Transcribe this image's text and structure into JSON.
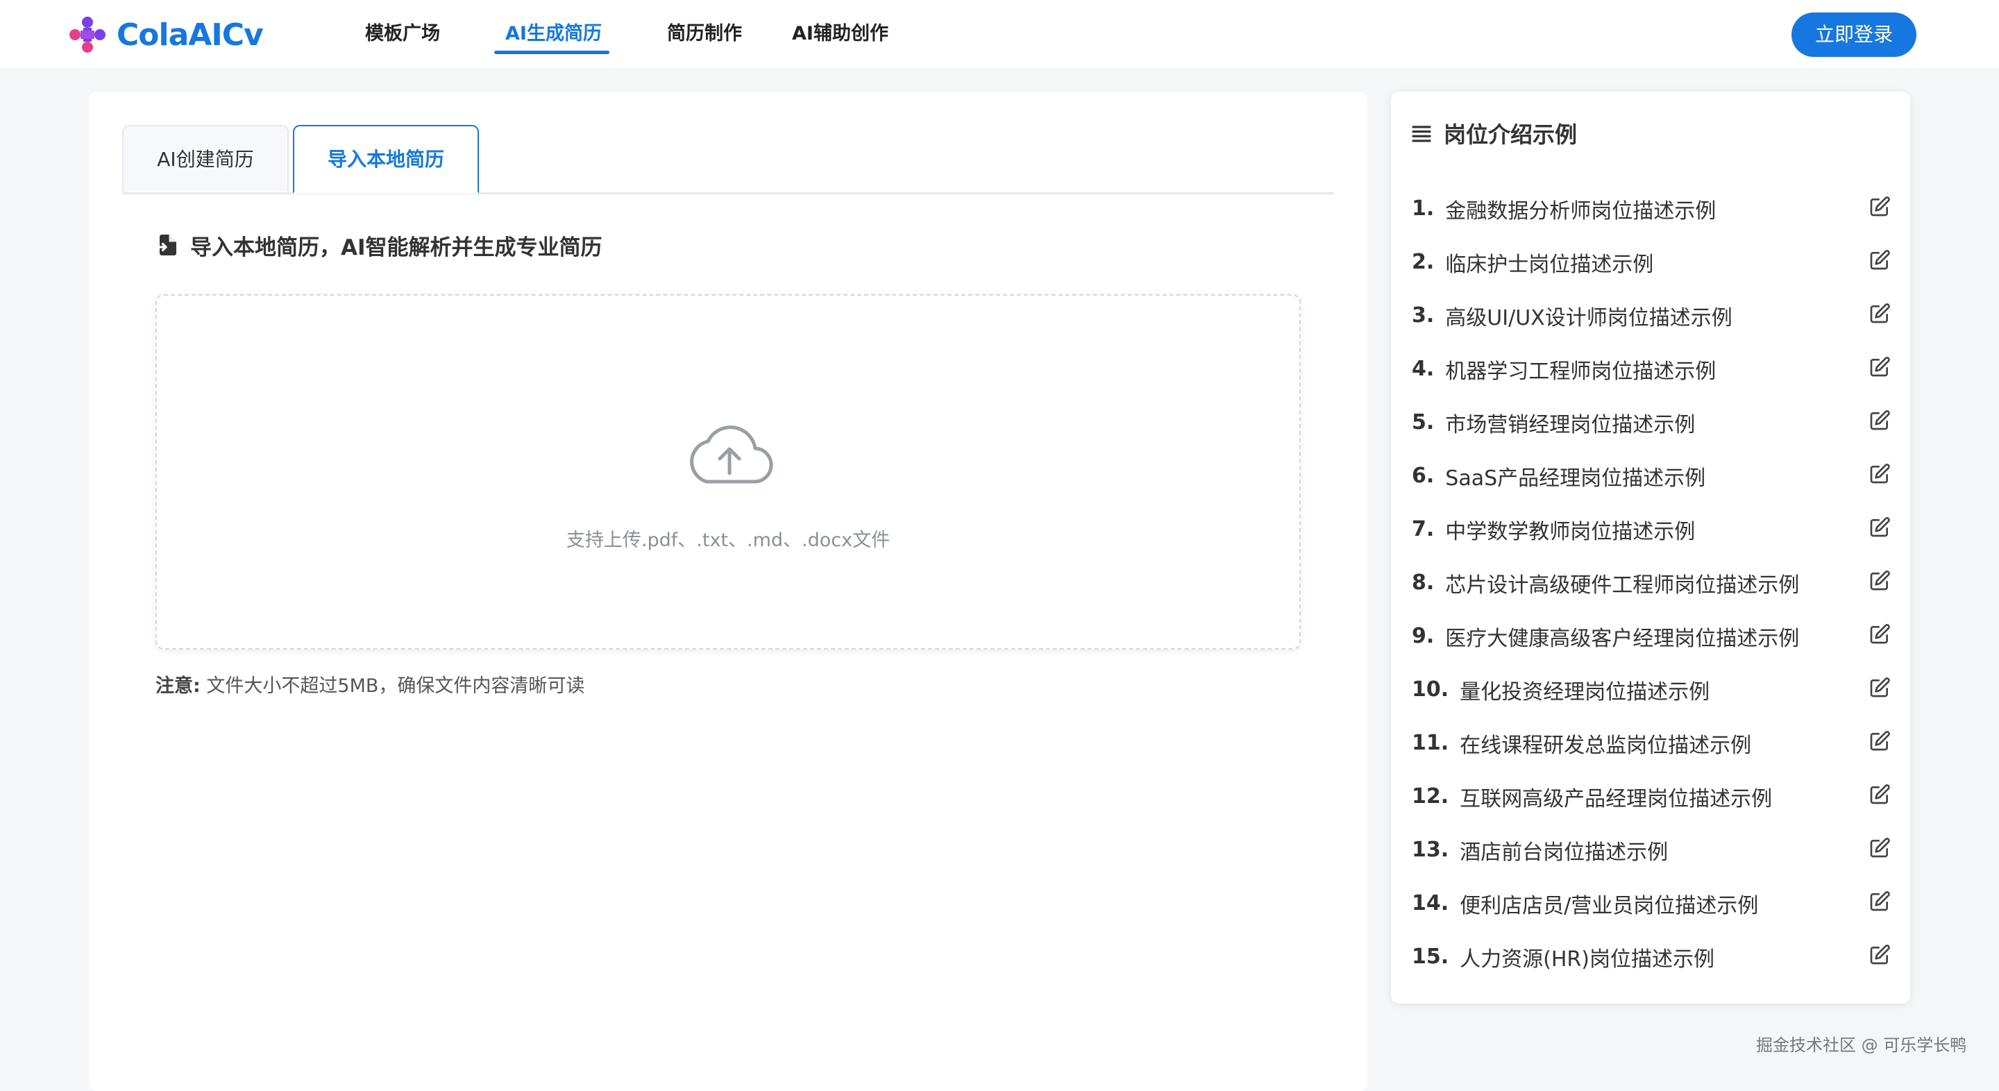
{
  "header": {
    "logo_text": "ColaAICv",
    "nav": [
      "模板广场",
      "AI生成简历",
      "简历制作",
      "AI辅助创作"
    ],
    "login_label": "立即登录"
  },
  "main": {
    "tabs": [
      "AI创建简历",
      "导入本地简历"
    ],
    "import_title": "导入本地简历，AI智能解析并生成专业简历",
    "upload_hint": "支持上传.pdf、.txt、.md、.docx文件",
    "note_label": "注意:",
    "note_text": "文件大小不超过5MB，确保文件内容清晰可读"
  },
  "sidebar": {
    "title": "岗位介绍示例",
    "items": [
      {
        "num": "1.",
        "title": "金融数据分析师岗位描述示例"
      },
      {
        "num": "2.",
        "title": "临床护士岗位描述示例"
      },
      {
        "num": "3.",
        "title": "高级UI/UX设计师岗位描述示例"
      },
      {
        "num": "4.",
        "title": "机器学习工程师岗位描述示例"
      },
      {
        "num": "5.",
        "title": "市场营销经理岗位描述示例"
      },
      {
        "num": "6.",
        "title": "SaaS产品经理岗位描述示例"
      },
      {
        "num": "7.",
        "title": "中学数学教师岗位描述示例"
      },
      {
        "num": "8.",
        "title": "芯片设计高级硬件工程师岗位描述示例"
      },
      {
        "num": "9.",
        "title": "医疗大健康高级客户经理岗位描述示例"
      },
      {
        "num": "10.",
        "title": "量化投资经理岗位描述示例"
      },
      {
        "num": "11.",
        "title": "在线课程研发总监岗位描述示例"
      },
      {
        "num": "12.",
        "title": "互联网高级产品经理岗位描述示例"
      },
      {
        "num": "13.",
        "title": "酒店前台岗位描述示例"
      },
      {
        "num": "14.",
        "title": "便利店店员/营业员岗位描述示例"
      },
      {
        "num": "15.",
        "title": "人力资源(HR)岗位描述示例"
      }
    ]
  },
  "footer": {
    "credit": "掘金技术社区 @ 可乐学长鸭"
  },
  "colors": {
    "accent": "#1677e0",
    "logo_purple": "#7b3fe4",
    "logo_pink": "#e83e8c"
  },
  "icons": {
    "logo": "colorful-grid-logo-icon",
    "import": "file-import-icon",
    "upload": "cloud-upload-icon",
    "list": "list-icon",
    "edit": "edit-icon"
  }
}
